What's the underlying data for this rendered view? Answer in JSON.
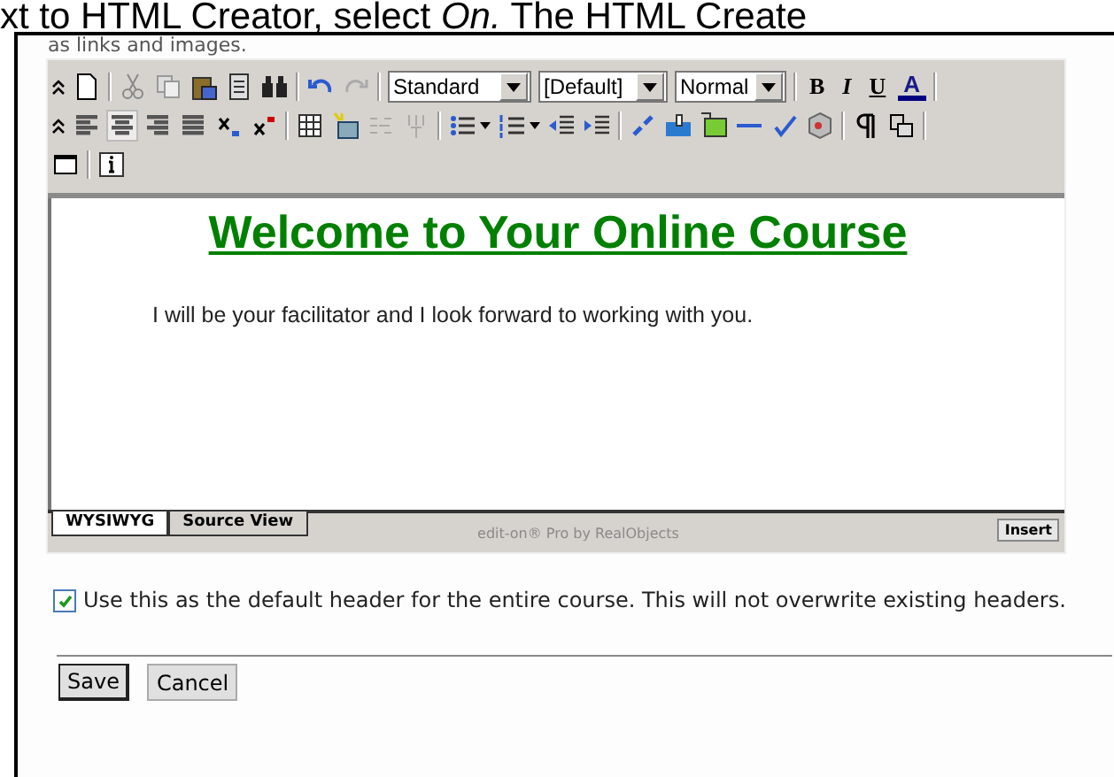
{
  "heading_fragment": "xt to HTML Creator, select *On.* The HTML Create",
  "intro_fragment": "as links and images.",
  "editor": {
    "toolbar": {
      "style_select": "Standard",
      "font_select": "[Default]",
      "size_select": "Normal",
      "format_buttons": [
        "B",
        "I",
        "U",
        "A"
      ],
      "alignment": [
        {
          "selected": false
        },
        {
          "selected": true
        },
        {
          "selected": false
        },
        {
          "selected": false
        }
      ]
    },
    "content": {
      "title": "Welcome to Your Online Course",
      "paragraph": "I will be your facilitator and I look forward to working with you."
    },
    "tabs": [
      {
        "label": "WYSIWYG",
        "selected": true
      },
      {
        "label": "Source View",
        "selected": false
      }
    ],
    "credit": "edit-on® Pro by RealObjects",
    "insert_button": "Insert"
  },
  "default_header": {
    "checked": true,
    "label": "Use this as the default header for the entire course. This will not overwrite existing headers."
  },
  "buttons": [
    "Save",
    "Cancel"
  ]
}
